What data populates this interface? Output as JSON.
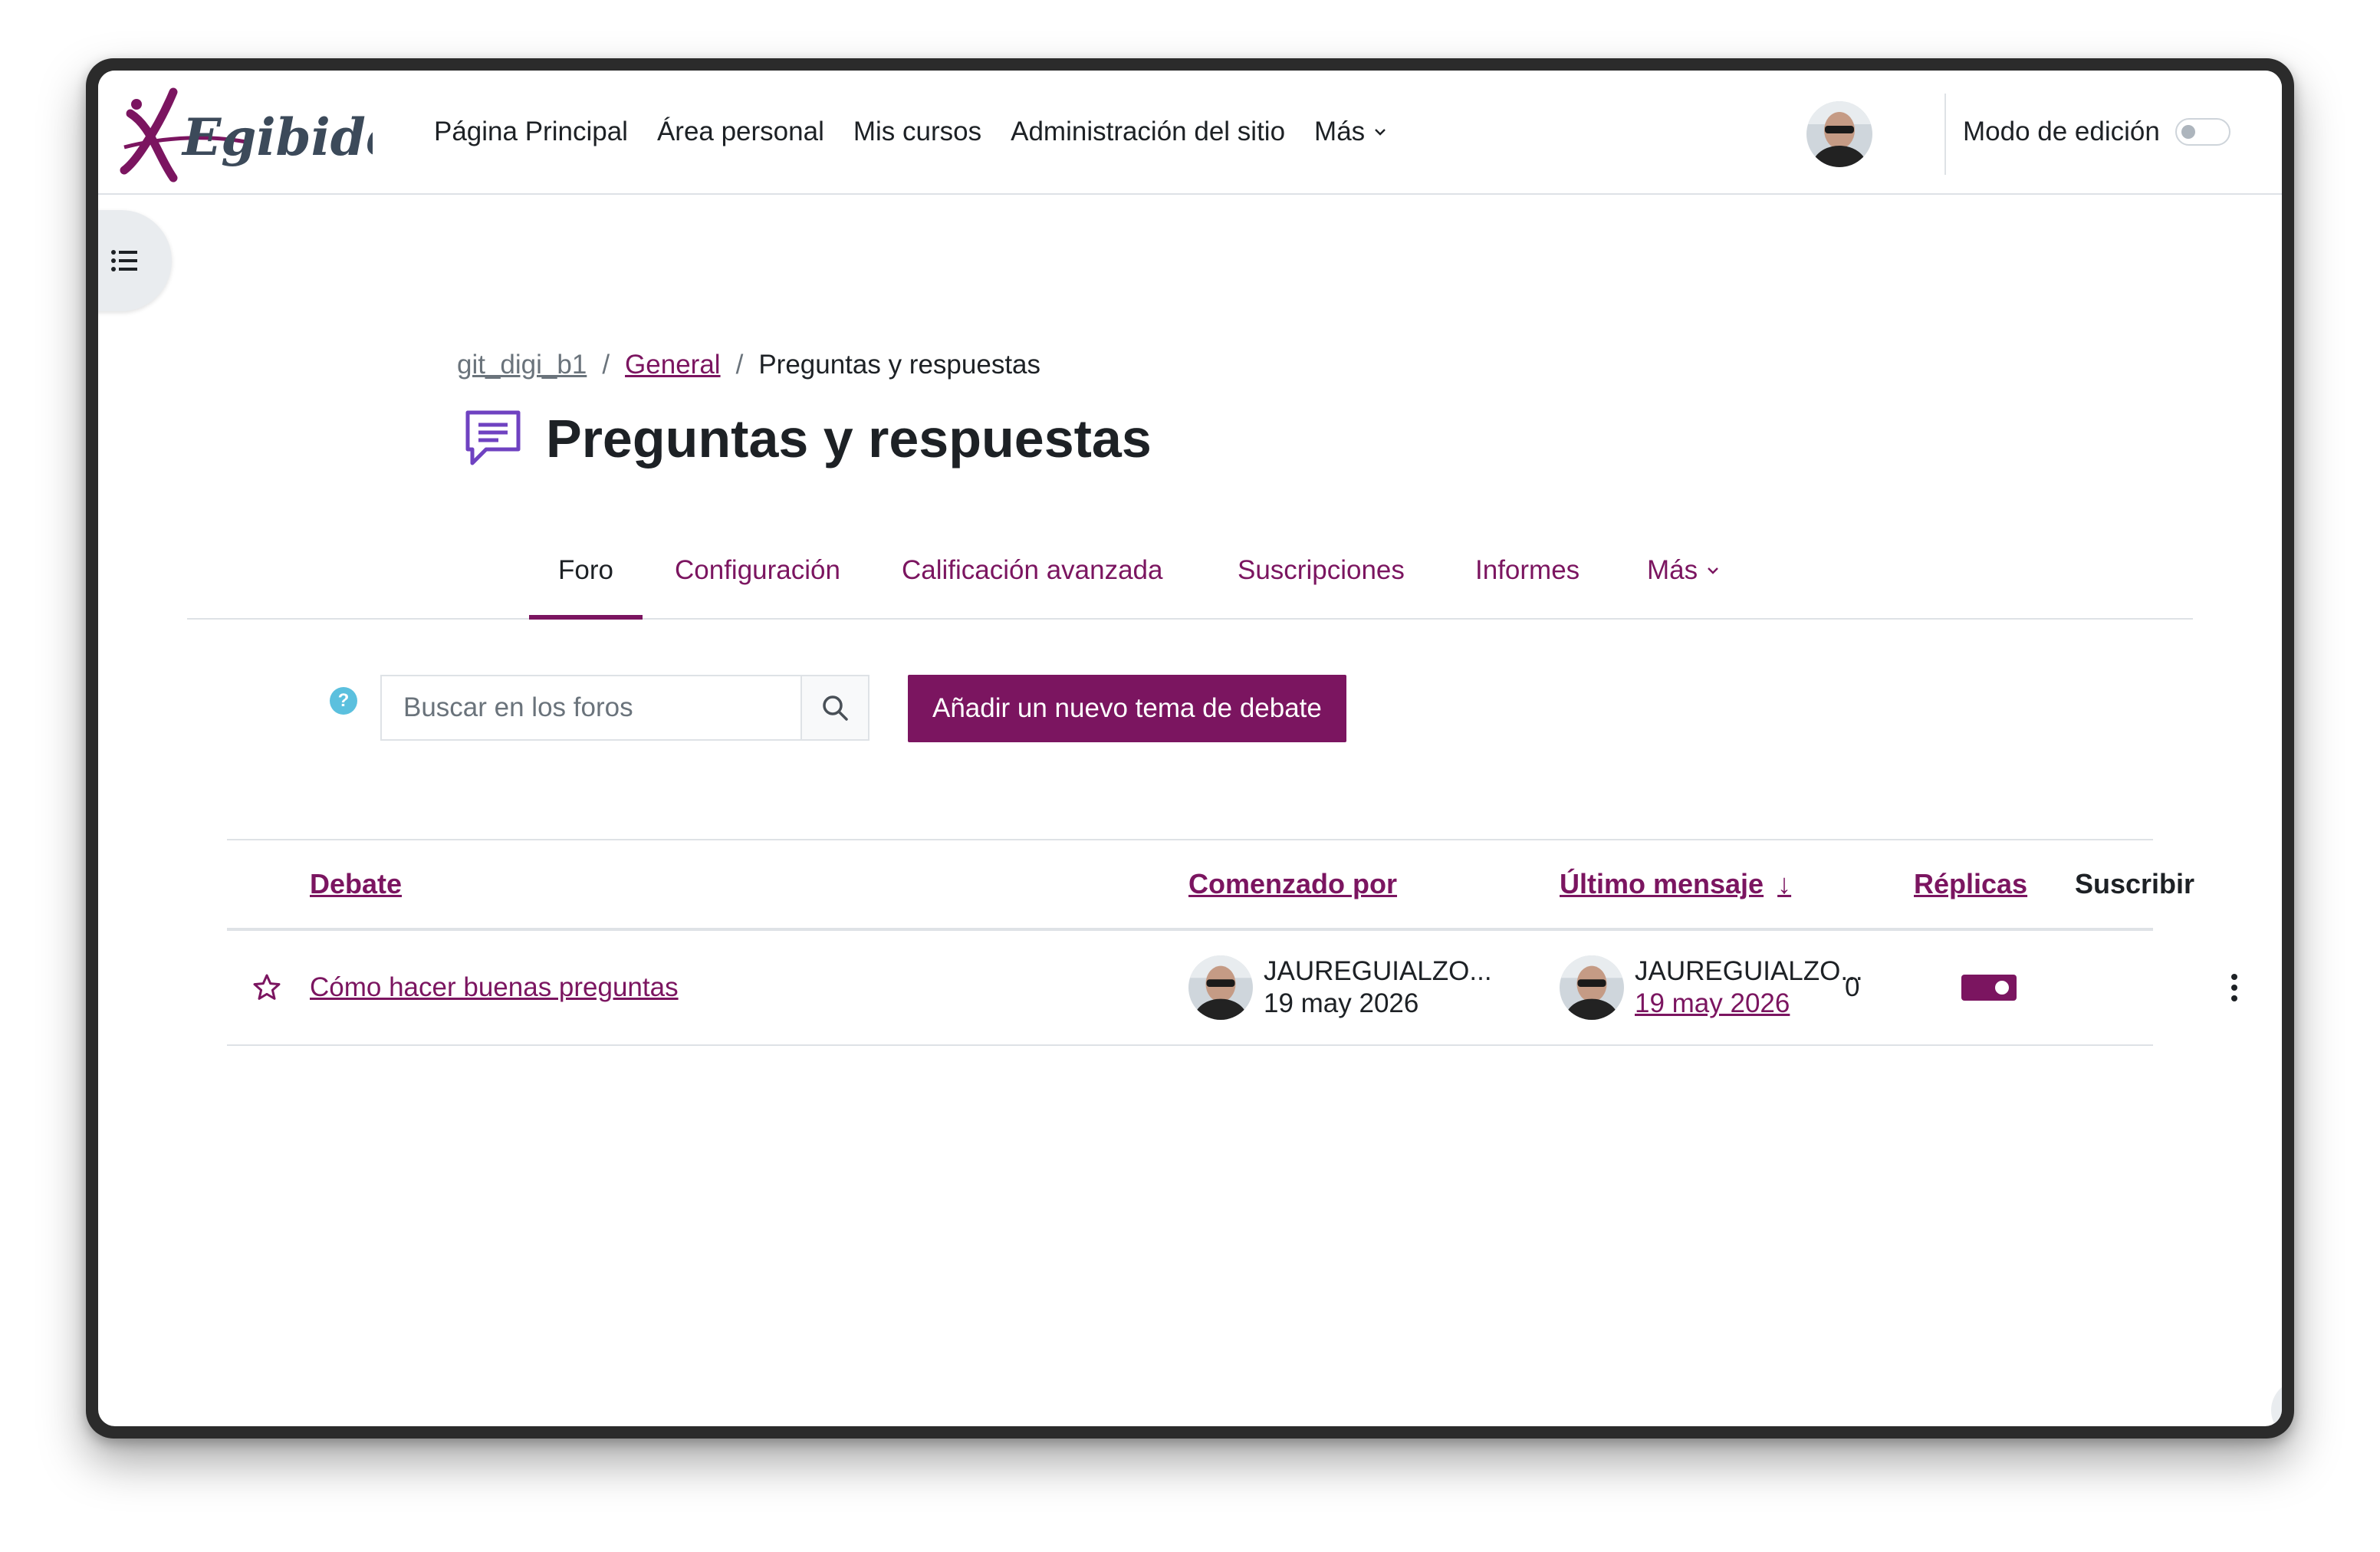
{
  "navbar": {
    "brand": "Egibide",
    "links": [
      "Página Principal",
      "Área personal",
      "Mis cursos",
      "Administración del sitio",
      "Más"
    ],
    "edit_mode_label": "Modo de edición",
    "edit_mode_on": false
  },
  "breadcrumb": {
    "course": "git_digi_b1",
    "section": "General",
    "current": "Preguntas y respuestas"
  },
  "page": {
    "title": "Preguntas y respuestas",
    "icon": "forum-chat-icon"
  },
  "tabs": [
    "Foro",
    "Configuración",
    "Calificación avanzada",
    "Suscripciones",
    "Informes",
    "Más"
  ],
  "active_tab": "Foro",
  "search": {
    "help_symbol": "?",
    "placeholder": "Buscar en los foros"
  },
  "add_button_label": "Añadir un nuevo tema de debate",
  "table": {
    "headers": {
      "debate": "Debate",
      "started_by": "Comenzado por",
      "last_post": "Último mensaje",
      "replies": "Réplicas",
      "subscribe": "Suscribir"
    },
    "sort_indicator": "↓",
    "rows": [
      {
        "topic": "Cómo hacer buenas preguntas",
        "started_by_name": "JAUREGUIALZO...",
        "started_by_date": "19 may 2026",
        "last_post_name": "JAUREGUIALZO...",
        "last_post_date": "19 may 2026",
        "replies": "0",
        "subscribed": true
      }
    ]
  },
  "help_fab": "?",
  "colors": {
    "brand": "#7b1560",
    "text": "#1d2125",
    "muted": "#6a737b",
    "border": "#dee2e6",
    "info": "#5bc0de"
  }
}
